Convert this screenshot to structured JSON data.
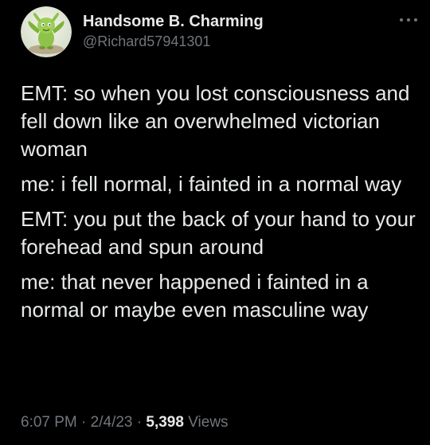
{
  "author": {
    "display_name": "Handsome B. Charming",
    "handle": "@Richard57941301",
    "avatar_icon": "cartoon-character-avatar"
  },
  "more_icon": "more-options-icon",
  "tweet": {
    "paragraphs": [
      "EMT: so when you lost consciousness and fell down like an overwhelmed victorian woman",
      "me: i fell normal, i fainted in a normal way",
      "EMT: you put the back of your hand to your forehead and spun around",
      "me: that never happened i fainted in a normal or maybe even masculine way"
    ]
  },
  "meta": {
    "time": "6:07 PM",
    "separator": "·",
    "date": "2/4/23",
    "views_count": "5,398",
    "views_label": "Views"
  },
  "colors": {
    "background": "#000000",
    "text_primary": "#e7e9ea",
    "text_secondary": "#71767b"
  }
}
